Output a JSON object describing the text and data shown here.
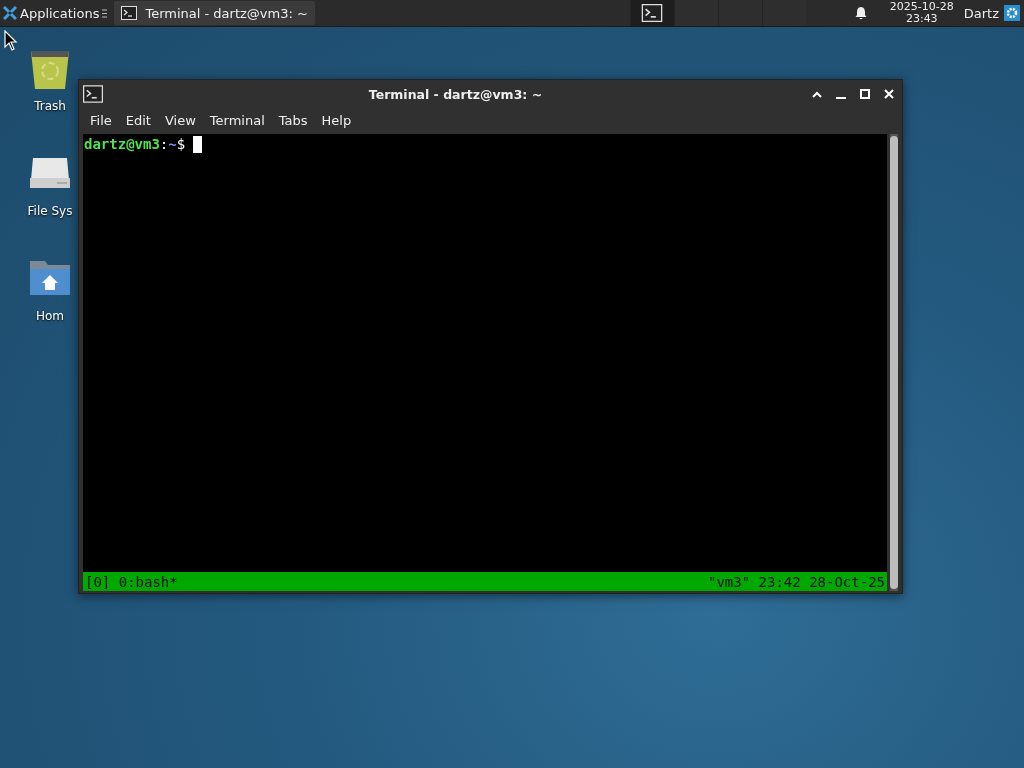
{
  "panel": {
    "applications_label": "Applications",
    "tasks": [
      {
        "title": "Terminal - dartz@vm3: ~",
        "selected": true
      }
    ],
    "workspaces": [
      {
        "selected": true
      },
      {
        "selected": false
      },
      {
        "selected": false
      },
      {
        "selected": false
      }
    ],
    "clock_date": "2025-10-28",
    "clock_time": "23:43",
    "user": "Dartz"
  },
  "desktop_icons": [
    {
      "kind": "trash",
      "label": "Trash"
    },
    {
      "kind": "drive",
      "label": "File Sys"
    },
    {
      "kind": "home",
      "label": "Hom"
    }
  ],
  "window": {
    "title": "Terminal - dartz@vm3: ~",
    "menu": [
      "File",
      "Edit",
      "View",
      "Terminal",
      "Tabs",
      "Help"
    ],
    "prompt": {
      "user_host": "dartz@vm3",
      "separator": ":",
      "path": "~",
      "symbol": "$"
    },
    "status_left": "[0] 0:bash*",
    "status_right": "\"vm3\" 23:42 28-Oct-25"
  }
}
